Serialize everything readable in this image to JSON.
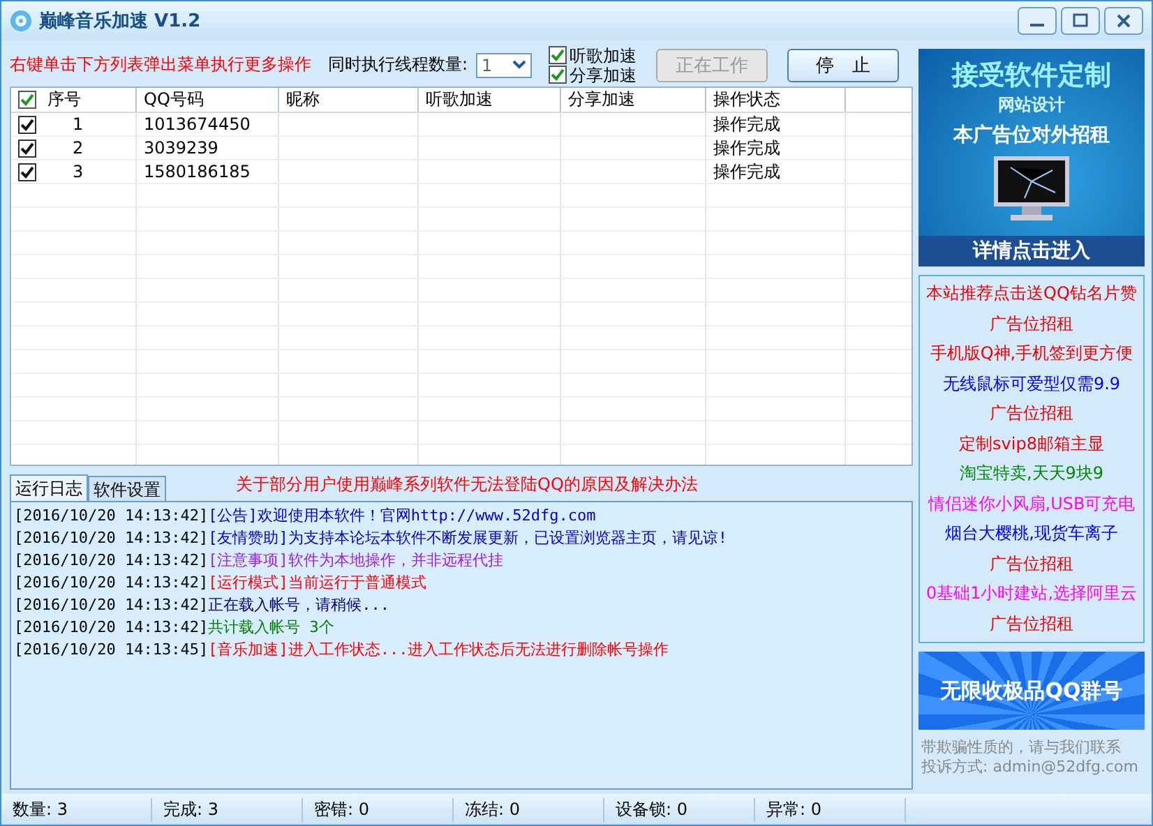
{
  "window": {
    "title": "巅峰音乐加速 V1.2"
  },
  "toolbar": {
    "hint": "右键单击下方列表弹出菜单执行更多操作",
    "threads_label": "同时执行线程数量:",
    "threads": {
      "value": "1"
    },
    "options": [
      {
        "label": "听歌加速",
        "checked": true
      },
      {
        "label": "分享加速",
        "checked": true
      }
    ],
    "buttons": [
      {
        "label": "正在工作",
        "disabled": true
      },
      {
        "label": "停　止",
        "disabled": false
      }
    ]
  },
  "table": {
    "all_checked": true,
    "columns": [
      "序号",
      "QQ号码",
      "昵称",
      "听歌加速",
      "分享加速",
      "操作状态"
    ],
    "rows": [
      {
        "checked": true,
        "index": "1",
        "qq": "1013674450",
        "status": "操作完成"
      },
      {
        "checked": true,
        "index": "2",
        "qq": "3039239",
        "status": "操作完成"
      },
      {
        "checked": true,
        "index": "3",
        "qq": "1580186185",
        "status": "操作完成"
      }
    ]
  },
  "log_tabs": [
    {
      "label": "运行日志",
      "selected": true
    },
    {
      "label": "软件设置",
      "selected": false
    }
  ],
  "notice": "关于部分用户使用巅峰系列软件无法登陆QQ的原因及解决办法",
  "log": [
    {
      "time": "[2016/10/20 14:13:42]",
      "message": "[公告]欢迎使用本软件！官网http://www.52dfg.com",
      "color": "#0000cc"
    },
    {
      "time": "[2016/10/20 14:13:42]",
      "message": "[友情赞助]为支持本论坛本软件不断发展更新，已设置浏览器主页，请见谅!",
      "color": "#0000cc"
    },
    {
      "time": "[2016/10/20 14:13:42]",
      "message": "[注意事项]软件为本地操作，并非远程代挂",
      "color": "#9b1fe8"
    },
    {
      "time": "[2016/10/20 14:13:42]",
      "message": "[运行模式]当前运行于普通模式",
      "color": "#ff0000"
    },
    {
      "time": "[2016/10/20 14:13:42]",
      "message": "正在载入帐号，请稍候...",
      "color": "#000080"
    },
    {
      "time": "[2016/10/20 14:13:42]",
      "message": "共计载入帐号 3个",
      "color": "#008000"
    },
    {
      "time": "[2016/10/20 14:13:45]",
      "message": "[音乐加速]进入工作状态...进入工作状态后无法进行删除帐号操作",
      "color": "#ff0000"
    }
  ],
  "status_bar": [
    "数量: 3",
    "完成: 3",
    "密错: 0",
    "冻结: 0",
    "设备锁: 0",
    "异常: 0"
  ],
  "sidebar": {
    "top_banner": {
      "lines": [
        "接受软件定制",
        "网站设计",
        "本广告位对外招租"
      ],
      "button": "详情点击进入"
    },
    "ads": [
      {
        "text": "本站推荐点击送QQ钻名片赞",
        "color": "#ee0000"
      },
      {
        "text": "广告位招租",
        "color": "#ee0000"
      },
      {
        "text": "手机版Q神,手机签到更方便",
        "color": "#ee0000"
      },
      {
        "text": "无线鼠标可爱型仅需9.9",
        "color": "#0000ee"
      },
      {
        "text": "广告位招租",
        "color": "#ee0000"
      },
      {
        "text": "定制svip8邮箱主显",
        "color": "#ee0000"
      },
      {
        "text": "淘宝特卖,天天9块9",
        "color": "#008800"
      },
      {
        "text": "情侣迷你小风扇,USB可充电",
        "color": "#ff00ff"
      },
      {
        "text": "烟台大樱桃,现货车离子",
        "color": "#0000ee"
      },
      {
        "text": "广告位招租",
        "color": "#ee0000"
      },
      {
        "text": "0基础1小时建站,选择阿里云",
        "color": "#ff00ff"
      },
      {
        "text": "广告位招租",
        "color": "#ee0000"
      }
    ],
    "bottom_banner": "无限收极品QQ群号",
    "disclaimer": [
      "带欺骗性质的，请与我们联系",
      "投诉方式: admin@52dfg.com"
    ]
  }
}
